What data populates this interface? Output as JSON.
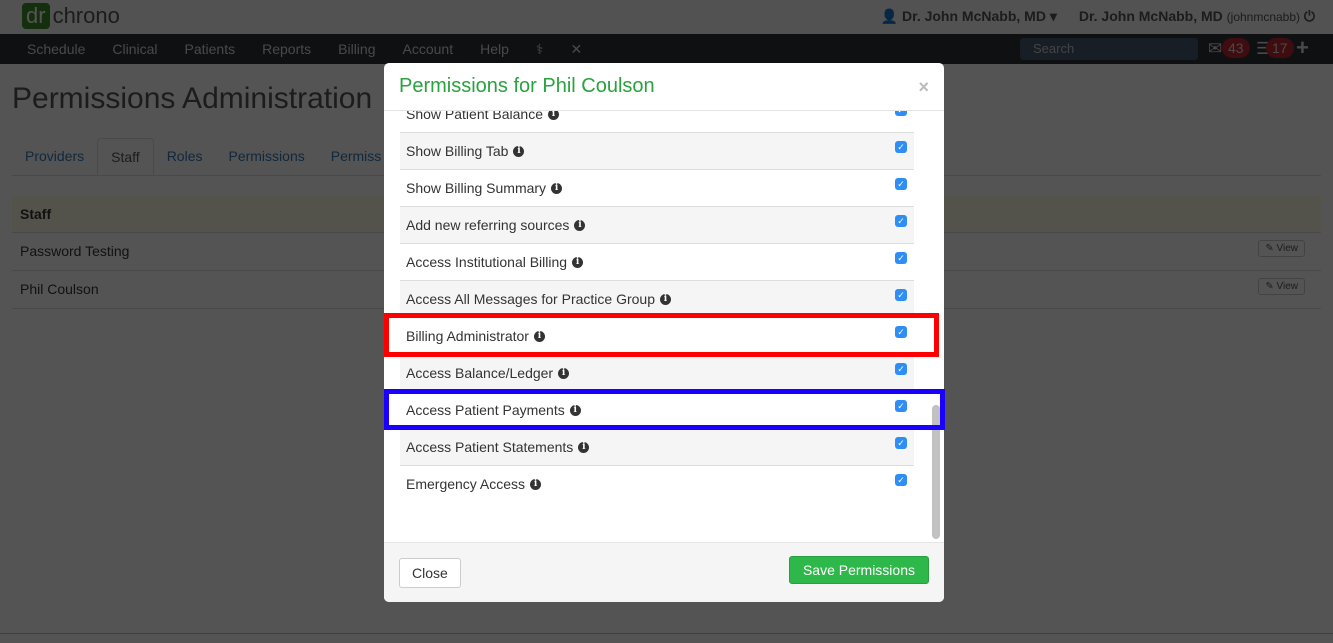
{
  "app": {
    "logo_dr": "dr",
    "logo_chrono": "chrono",
    "user_menu": "Dr. John McNabb, MD",
    "user_name": "Dr. John McNabb, MD",
    "username": "(johnmcnabb)"
  },
  "nav": {
    "items": [
      "Schedule",
      "Clinical",
      "Patients",
      "Reports",
      "Billing",
      "Account",
      "Help"
    ],
    "search_placeholder": "Search",
    "messages_count": "43",
    "tasks_count": "17"
  },
  "page": {
    "title": "Permissions Administration",
    "help": "?",
    "tabs": [
      "Providers",
      "Staff",
      "Roles",
      "Permissions",
      "Permiss"
    ],
    "active_tab": "Staff",
    "table_header": "Staff",
    "rows": [
      "Password Testing",
      "Phil Coulson"
    ],
    "view_label": "View"
  },
  "modal": {
    "title": "Permissions for Phil Coulson",
    "close_x": "×",
    "permissions": [
      {
        "label": "Show Patient Balance",
        "checked": true
      },
      {
        "label": "Show Billing Tab",
        "checked": true
      },
      {
        "label": "Show Billing Summary",
        "checked": true
      },
      {
        "label": "Add new referring sources",
        "checked": true
      },
      {
        "label": "Access Institutional Billing",
        "checked": true
      },
      {
        "label": "Access All Messages for Practice Group",
        "checked": true
      },
      {
        "label": "Billing Administrator",
        "checked": true
      },
      {
        "label": "Access Balance/Ledger",
        "checked": true
      },
      {
        "label": "Access Patient Payments",
        "checked": true
      },
      {
        "label": "Access Patient Statements",
        "checked": true
      },
      {
        "label": "Emergency Access",
        "checked": true
      }
    ],
    "close_label": "Close",
    "save_label": "Save Permissions"
  },
  "highlights": {
    "red": "#ff0000",
    "blue": "#1a00ff"
  }
}
